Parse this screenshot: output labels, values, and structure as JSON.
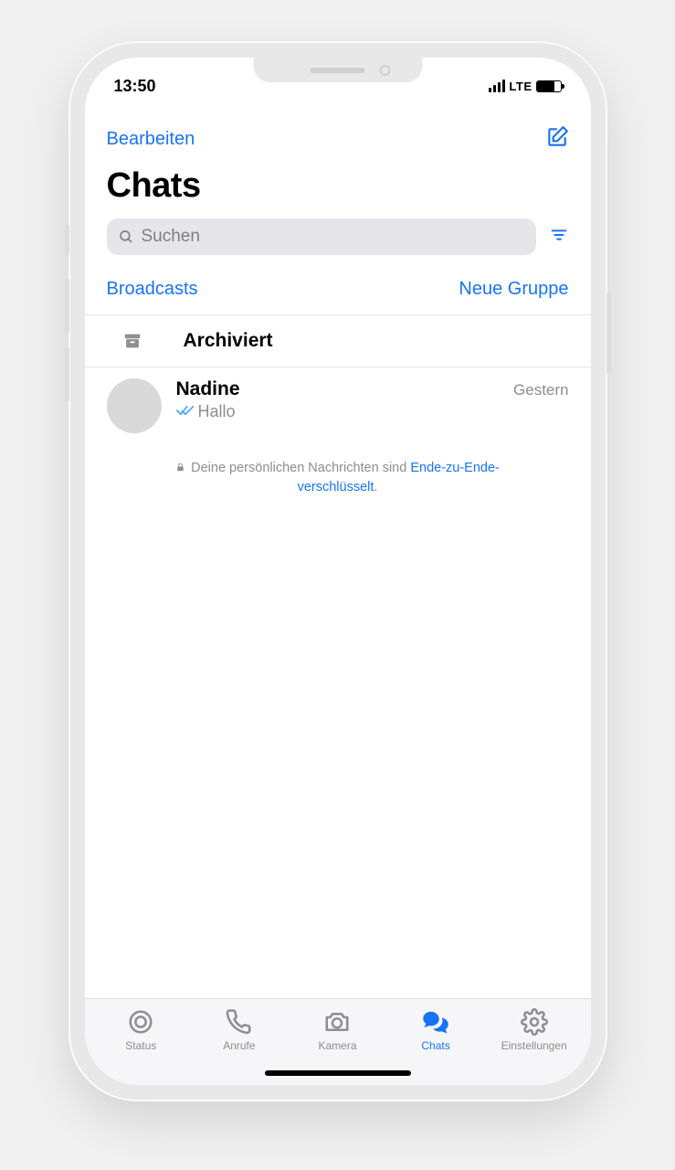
{
  "status": {
    "time": "13:50",
    "network": "LTE"
  },
  "header": {
    "edit": "Bearbeiten",
    "title": "Chats",
    "search_placeholder": "Suchen",
    "broadcasts": "Broadcasts",
    "new_group": "Neue Gruppe",
    "archived": "Archiviert"
  },
  "chats": [
    {
      "name": "Nadine",
      "message": "Hallo",
      "time": "Gestern",
      "read": true
    }
  ],
  "encryption": {
    "prefix": "Deine persönlichen Nachrichten sind ",
    "link": "Ende-zu-Ende-verschlüsselt",
    "suffix": "."
  },
  "tabs": {
    "status": "Status",
    "calls": "Anrufe",
    "camera": "Kamera",
    "chats": "Chats",
    "settings": "Einstellungen"
  },
  "colors": {
    "accent": "#1874f5"
  }
}
